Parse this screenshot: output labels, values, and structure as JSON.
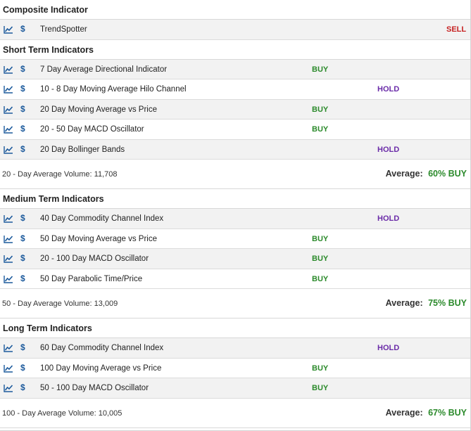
{
  "composite": {
    "title": "Composite Indicator",
    "rows": [
      {
        "name": "TrendSpotter",
        "signal": "SELL",
        "type": "sell"
      }
    ]
  },
  "short_term": {
    "title": "Short Term Indicators",
    "rows": [
      {
        "name": "7 Day Average Directional Indicator",
        "signal": "BUY",
        "type": "buy"
      },
      {
        "name": "10 - 8 Day Moving Average Hilo Channel",
        "signal": "HOLD",
        "type": "hold"
      },
      {
        "name": "20 Day Moving Average vs Price",
        "signal": "BUY",
        "type": "buy"
      },
      {
        "name": "20 - 50 Day MACD Oscillator",
        "signal": "BUY",
        "type": "buy"
      },
      {
        "name": "20 Day Bollinger Bands",
        "signal": "HOLD",
        "type": "hold"
      }
    ],
    "volume": "20 - Day Average Volume: 11,708",
    "average_label": "Average:",
    "average_value": "60% BUY"
  },
  "medium_term": {
    "title": "Medium Term Indicators",
    "rows": [
      {
        "name": "40 Day Commodity Channel Index",
        "signal": "HOLD",
        "type": "hold"
      },
      {
        "name": "50 Day Moving Average vs Price",
        "signal": "BUY",
        "type": "buy"
      },
      {
        "name": "20 - 100 Day MACD Oscillator",
        "signal": "BUY",
        "type": "buy"
      },
      {
        "name": "50 Day Parabolic Time/Price",
        "signal": "BUY",
        "type": "buy"
      }
    ],
    "volume": "50 - Day Average Volume: 13,009",
    "average_label": "Average:",
    "average_value": "75% BUY"
  },
  "long_term": {
    "title": "Long Term Indicators",
    "rows": [
      {
        "name": "60 Day Commodity Channel Index",
        "signal": "HOLD",
        "type": "hold"
      },
      {
        "name": "100 Day Moving Average vs Price",
        "signal": "BUY",
        "type": "buy"
      },
      {
        "name": "50 - 100 Day MACD Oscillator",
        "signal": "BUY",
        "type": "buy"
      }
    ],
    "volume": "100 - Day Average Volume: 10,005",
    "average_label": "Average:",
    "average_value": "67% BUY"
  },
  "icons": {
    "chart": "line-chart-icon",
    "dollar": "$"
  },
  "colors": {
    "buy": "#2b8a2b",
    "hold": "#6a2ba8",
    "sell": "#c62121",
    "row_alt": "#f2f2f2"
  }
}
